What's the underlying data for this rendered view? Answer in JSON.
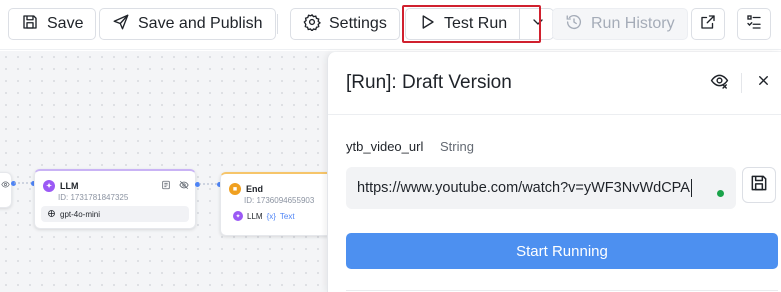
{
  "toolbar": {
    "save_label": "Save",
    "save_publish_label": "Save and Publish",
    "settings_label": "Settings",
    "test_run_label": "Test Run",
    "run_history_label": "Run History",
    "icons": {
      "save": "save-icon",
      "publish": "send-icon",
      "settings": "gear-icon",
      "test_run": "play-icon",
      "dropdown": "chevron-down-icon",
      "history": "history-icon",
      "open": "external-link-icon",
      "checklist": "checklist-icon"
    },
    "highlight_color": "#d0202e"
  },
  "canvas": {
    "nodes": [
      {
        "title": "LLM",
        "id_text": "ID: 1731781847325",
        "model": "gpt-4o-mini",
        "badge_color": "#9b59f5"
      },
      {
        "title": "End",
        "id_text": "ID: 1736094655903",
        "output_source": "LLM",
        "output_var_icon": "{x}",
        "output_var": "Text",
        "badge_color": "#f0a020"
      }
    ]
  },
  "panel": {
    "title": "[Run]: Draft Version",
    "field_label": "ytb_video_url",
    "field_type": "String",
    "field_value": "https://www.youtube.com/watch?v=yWF3NvWdCPA",
    "start_button_label": "Start Running",
    "accent_color": "#4d90f0",
    "icons": {
      "visibility": "eye-off-icon",
      "close": "close-icon",
      "save_field": "save-icon"
    }
  }
}
